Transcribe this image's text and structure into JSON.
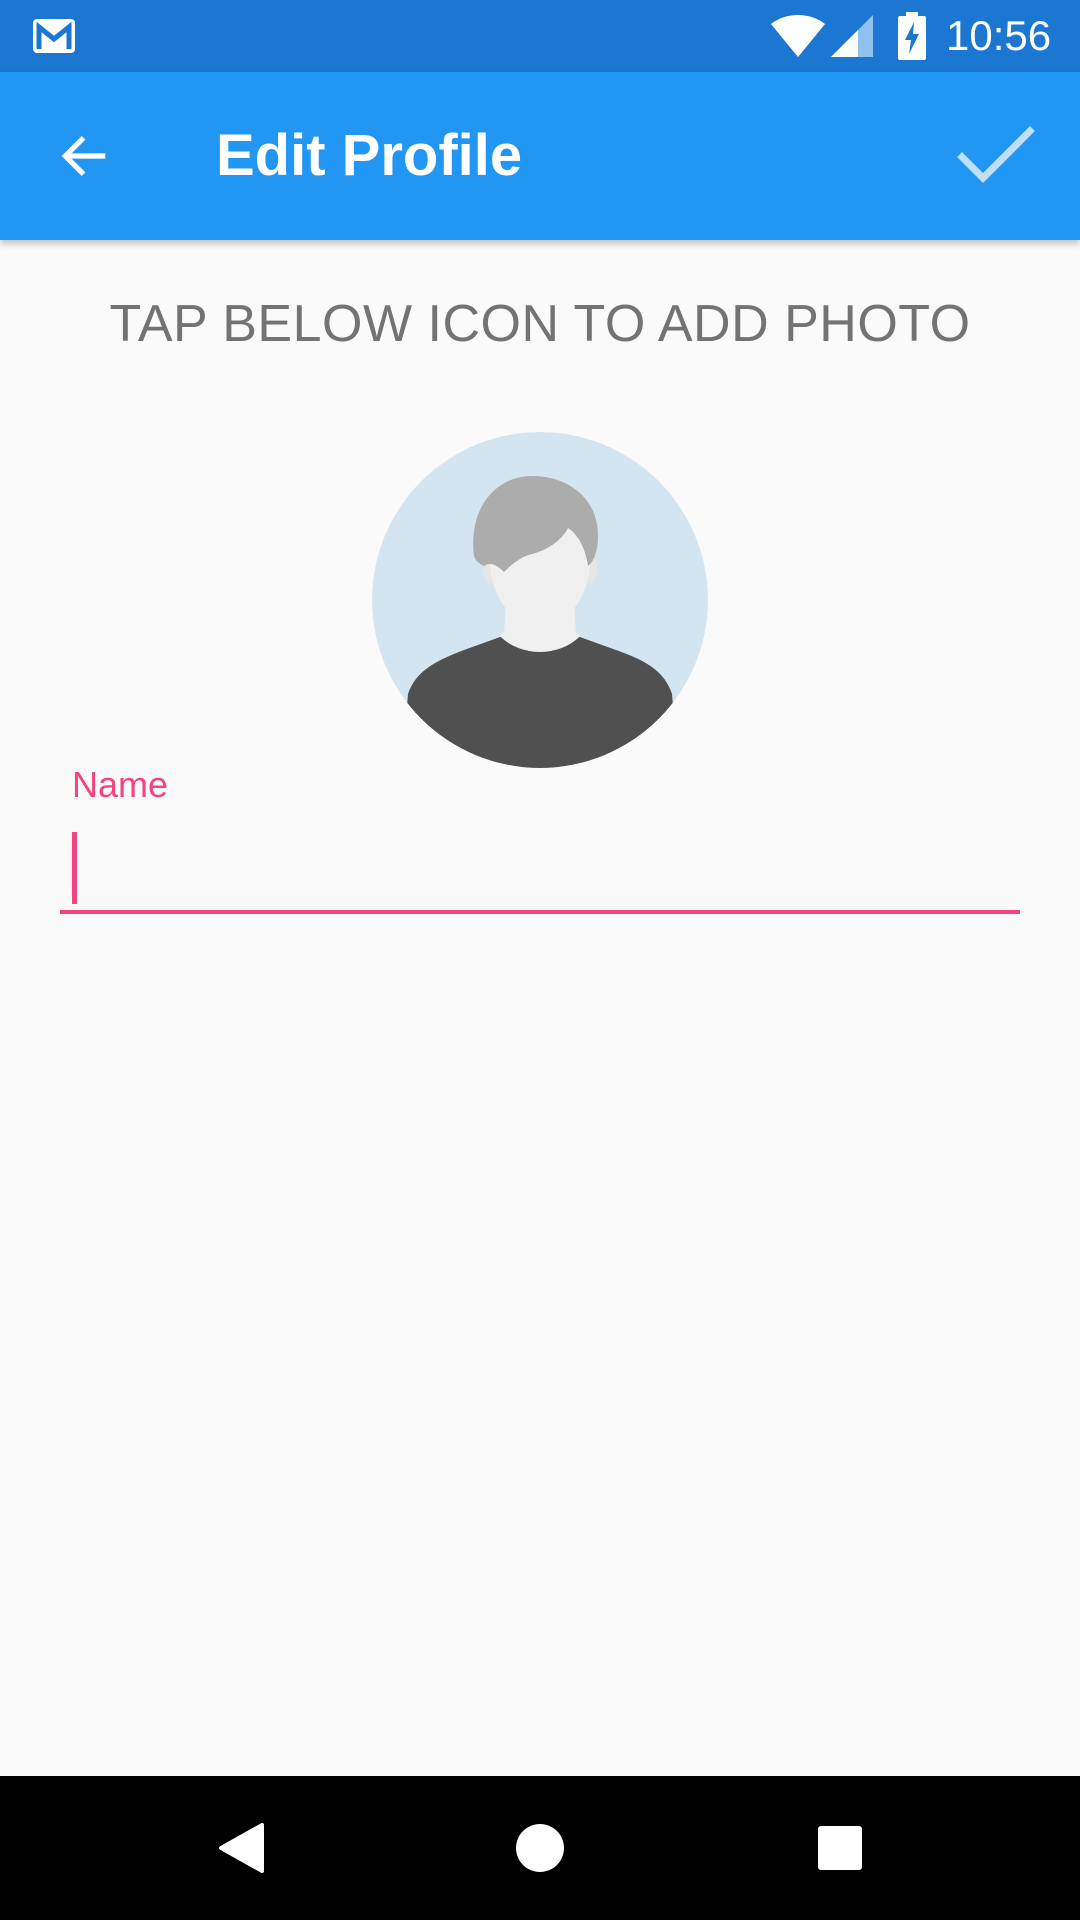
{
  "status_bar": {
    "time": "10:56",
    "icons": [
      "gmail-icon",
      "wifi-icon",
      "signal-icon",
      "battery-charging-icon"
    ],
    "background_color": "#1b77d2"
  },
  "app_bar": {
    "title": "Edit Profile",
    "back_icon": "arrow-left-icon",
    "save_icon": "checkmark-icon",
    "background_color": "#2196f3"
  },
  "content": {
    "hint": "TAP BELOW ICON TO ADD PHOTO",
    "avatar_icon": "default-avatar-icon",
    "name_field": {
      "label": "Name",
      "value": "",
      "accent_color": "#f2457f"
    }
  },
  "nav_bar": {
    "icons": [
      "nav-back-icon",
      "nav-home-icon",
      "nav-recents-icon"
    ]
  }
}
